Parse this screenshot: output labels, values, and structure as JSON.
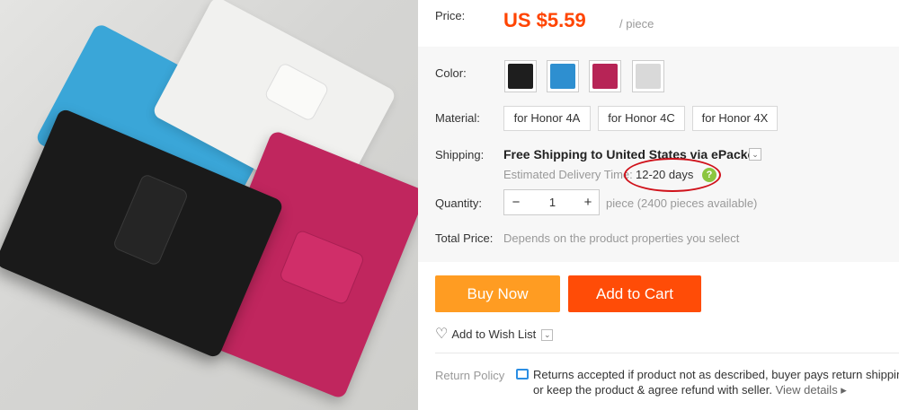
{
  "product": {
    "price_label": "Price:",
    "price": "US $5.59",
    "unit": "/ piece",
    "color_label": "Color:",
    "colors": [
      {
        "name": "black",
        "hex": "#1e1e1e"
      },
      {
        "name": "blue",
        "hex": "#2e8fd0"
      },
      {
        "name": "rose",
        "hex": "#b72456"
      },
      {
        "name": "white",
        "hex": "#d9d9d9"
      }
    ],
    "material_label": "Material:",
    "materials": [
      "for Honor 4A",
      "for Honor 4C",
      "for Honor 4X"
    ],
    "shipping_label": "Shipping:",
    "shipping_main": "Free Shipping to United States via ePacket",
    "shipping_caret": "⌄",
    "estimated_label": "Estimated Delivery Time:",
    "estimated_days": "12-20 days",
    "help_icon": "?",
    "quantity_label": "Quantity:",
    "quantity_minus": "−",
    "quantity_value": "1",
    "quantity_plus": "+",
    "quantity_available": "piece (2400 pieces available)",
    "total_label": "Total Price:",
    "total_value": "Depends on the product properties you select",
    "buy_now": "Buy Now",
    "add_to_cart": "Add to Cart",
    "wish_icon": "♡",
    "wish_label": "Add to Wish List",
    "wish_caret": "⌄",
    "return_label": "Return Policy",
    "return_line1": "Returns accepted if product not as described, buyer pays return shipping",
    "return_line2": "or keep the product & agree refund with seller.",
    "return_link": "View details ▸",
    "accent_color": "#ff4400"
  }
}
